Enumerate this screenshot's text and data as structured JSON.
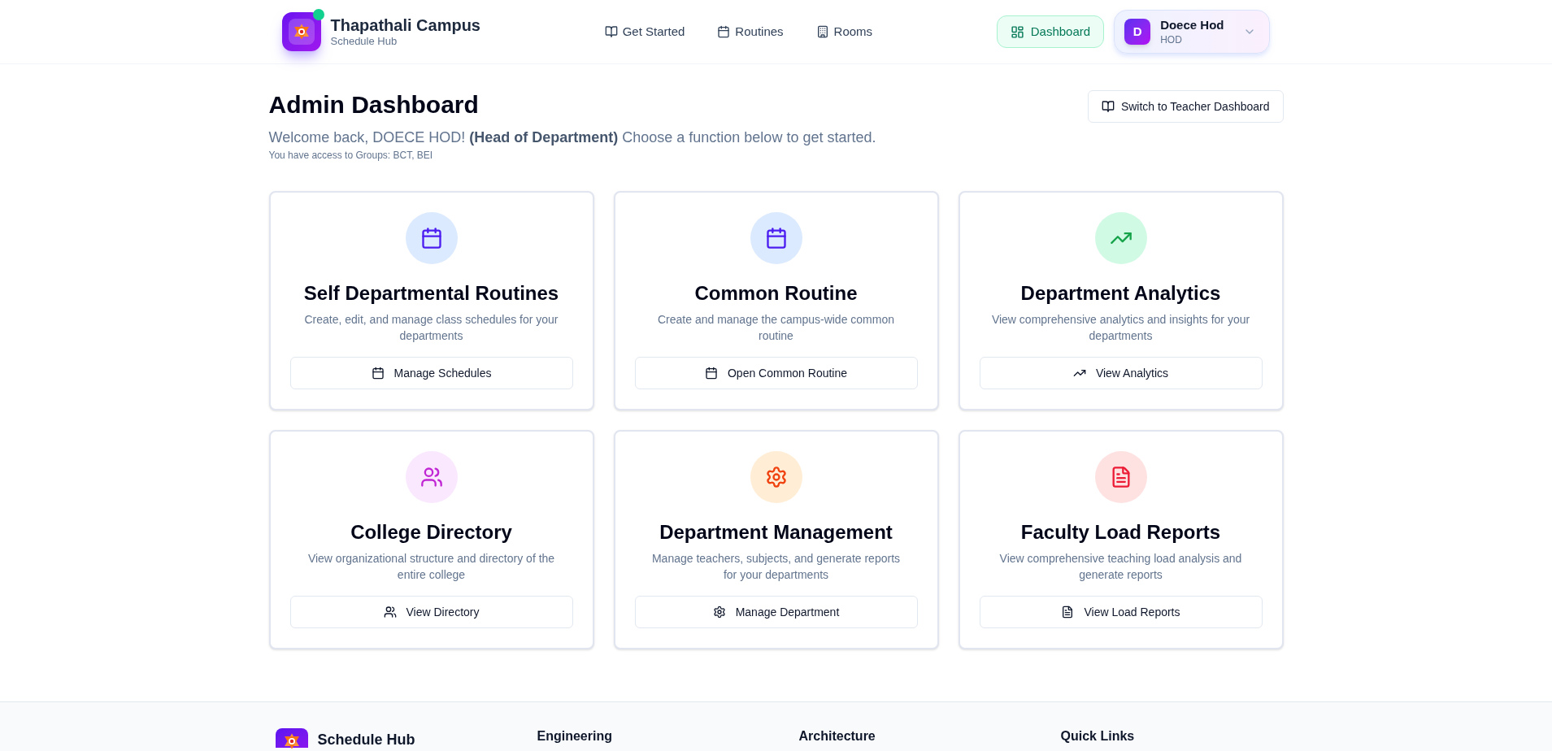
{
  "header": {
    "brand": {
      "title": "Thapathali Campus",
      "subtitle": "Schedule Hub",
      "online": true
    },
    "nav": [
      {
        "label": "Get Started",
        "selected": false
      },
      {
        "label": "Routines",
        "selected": false
      },
      {
        "label": "Rooms",
        "selected": false
      }
    ],
    "dashboard_link": {
      "label": "Dashboard",
      "selected": true
    },
    "user_menu": {
      "avatar_initial": "D",
      "name": "Doece Hod",
      "role": "HOD"
    }
  },
  "page": {
    "title": "Admin Dashboard",
    "welcome": "Welcome back, DOECE HOD! **(Head of Department)** Choose a function below to get started.",
    "access_note": "You have access to Groups: BCT, BEI",
    "switch_button": "Switch to Teacher Dashboard"
  },
  "cards": [
    {
      "title": "Self Departmental Routines",
      "description": "Create, edit, and manage class schedules for your departments",
      "button": "Manage Schedules",
      "color": "#4c1df0"
    },
    {
      "title": "Common Routine",
      "description": "Create and manage the campus-wide common routine",
      "button": "Open Common Routine",
      "color": "#4c1df0"
    },
    {
      "title": "Department Analytics",
      "description": "View comprehensive analytics and insights for your departments",
      "button": "View Analytics",
      "color": "#16a34a"
    },
    {
      "title": "College Directory",
      "description": "View organizational structure and directory of the entire college",
      "button": "View Directory",
      "color": "#c026d3"
    },
    {
      "title": "Department Management",
      "description": "Manage teachers, subjects, and generate reports for your departments",
      "button": "Manage Department",
      "color": "#f0420f"
    },
    {
      "title": "Faculty Load Reports",
      "description": "View comprehensive teaching load analysis and generate reports",
      "button": "View Load Reports",
      "color": "#ec1c36"
    }
  ],
  "footer": {
    "brand": "Schedule Hub",
    "columns": [
      {
        "heading": "Engineering"
      },
      {
        "heading": "Architecture"
      },
      {
        "heading": "Quick Links"
      }
    ]
  }
}
